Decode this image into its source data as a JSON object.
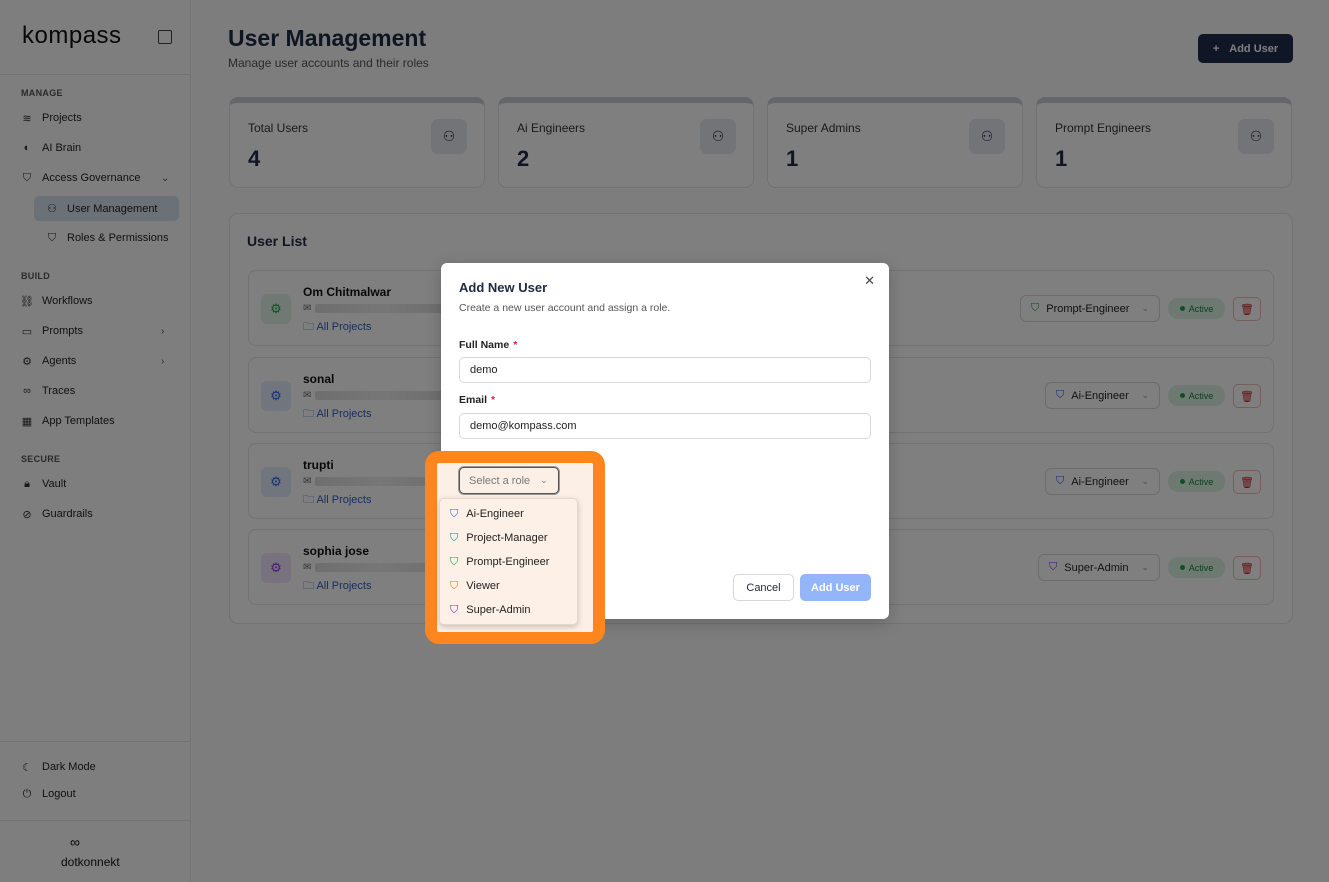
{
  "sidebar": {
    "logo": "kompass",
    "sections": {
      "manage": "MANAGE",
      "build": "BUILD",
      "secure": "SECURE"
    },
    "items": {
      "projects": "Projects",
      "ai_brain": "AI Brain",
      "access_governance": "Access Governance",
      "user_management": "User Management",
      "roles_permissions": "Roles & Permissions",
      "workflows": "Workflows",
      "prompts": "Prompts",
      "agents": "Agents",
      "traces": "Traces",
      "app_templates": "App Templates",
      "vault": "Vault",
      "guardrails": "Guardrails",
      "dark_mode": "Dark Mode",
      "logout": "Logout"
    },
    "footer_logo": "dotkonnekt"
  },
  "header": {
    "title": "User Management",
    "subtitle": "Manage user accounts and their roles",
    "add_user": "Add User"
  },
  "stats": [
    {
      "label": "Total Users",
      "value": "4"
    },
    {
      "label": "Ai Engineers",
      "value": "2"
    },
    {
      "label": "Super Admins",
      "value": "1"
    },
    {
      "label": "Prompt Engineers",
      "value": "1"
    }
  ],
  "user_list": {
    "title": "User List",
    "users": [
      {
        "name": "Om Chitmalwar",
        "projects": "All Projects",
        "role": "Prompt-Engineer",
        "status": "Active",
        "color": "#16a34a"
      },
      {
        "name": "sonal",
        "projects": "All Projects",
        "role": "Ai-Engineer",
        "status": "Active",
        "color": "#2563eb"
      },
      {
        "name": "trupti",
        "projects": "All Projects",
        "role": "Ai-Engineer",
        "status": "Active",
        "color": "#2563eb"
      },
      {
        "name": "sophia jose",
        "projects": "All Projects",
        "role": "Super-Admin",
        "status": "Active",
        "color": "#9333ea"
      }
    ]
  },
  "modal": {
    "title": "Add New User",
    "subtitle": "Create a new user account and assign a role.",
    "full_name_label": "Full Name",
    "full_name_value": "demo",
    "email_label": "Email",
    "email_value": "demo@kompass.com",
    "required_mark": "*",
    "role_placeholder": "Select a role",
    "cancel": "Cancel",
    "submit": "Add User",
    "role_options": [
      {
        "label": "Ai-Engineer",
        "color": "#3b5bdb"
      },
      {
        "label": "Project-Manager",
        "color": "#0f8a8a"
      },
      {
        "label": "Prompt-Engineer",
        "color": "#16a34a"
      },
      {
        "label": "Viewer",
        "color": "#ea7c0c"
      },
      {
        "label": "Super-Admin",
        "color": "#a21caf"
      }
    ]
  },
  "highlight_color": "#ff861c"
}
